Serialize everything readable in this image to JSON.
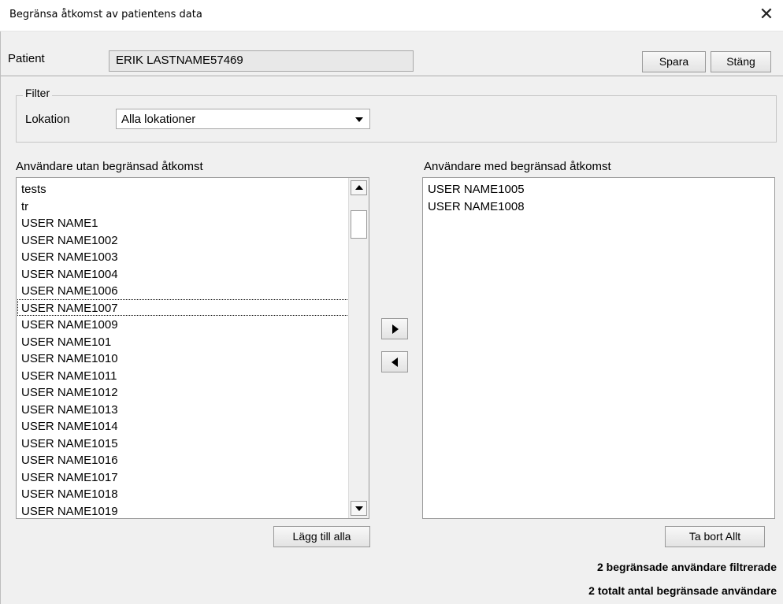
{
  "window": {
    "title": "Begränsa åtkomst av patientens data",
    "close_glyph": "✕"
  },
  "patient": {
    "label": "Patient",
    "name": "ERIK LASTNAME57469"
  },
  "actions": {
    "save_label": "Spara",
    "close_label": "Stäng"
  },
  "filter": {
    "legend": "Filter",
    "location_label": "Lokation",
    "location_value": "Alla lokationer"
  },
  "left_list": {
    "title": "Användare utan begränsad åtkomst",
    "items": [
      "tests",
      "tr",
      "USER NAME1",
      "USER NAME1002",
      "USER NAME1003",
      "USER NAME1004",
      "USER NAME1006",
      "USER NAME1007",
      "USER NAME1009",
      "USER NAME101",
      "USER NAME1010",
      "USER NAME1011",
      "USER NAME1012",
      "USER NAME1013",
      "USER NAME1014",
      "USER NAME1015",
      "USER NAME1016",
      "USER NAME1017",
      "USER NAME1018",
      "USER NAME1019"
    ],
    "focused_item": "USER NAME1007",
    "add_all_label": "Lägg till alla"
  },
  "right_list": {
    "title": "Användare med begränsad åtkomst",
    "items": [
      "USER NAME1005",
      "USER NAME1008"
    ],
    "remove_all_label": "Ta bort Allt"
  },
  "status": {
    "filtered": "2 begränsade användare filtrerade",
    "total": "2 totalt antal begränsade användare"
  },
  "icons": {
    "close": "close-icon",
    "dropdown": "dropdown-arrow-icon",
    "move_right": "arrow-right-icon",
    "move_left": "arrow-left-icon"
  }
}
